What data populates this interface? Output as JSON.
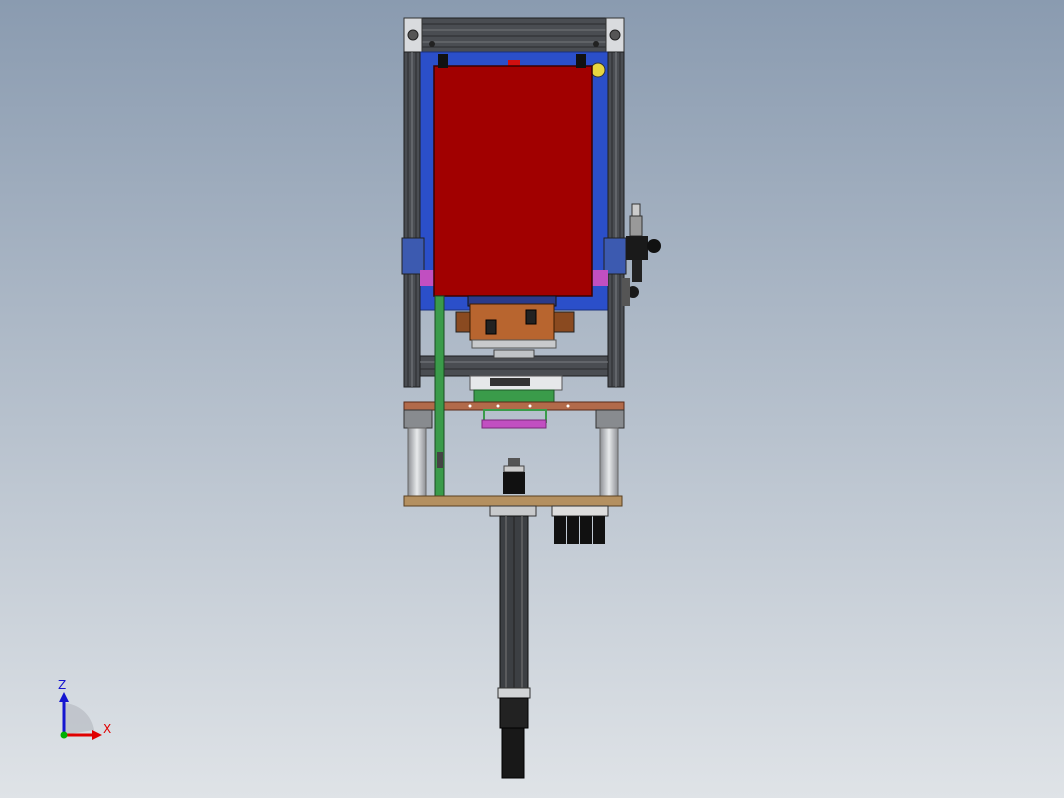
{
  "viewport": {
    "background_top": "#8a9bb0",
    "background_bottom": "#dfe3e7"
  },
  "colors": {
    "frame_gray": "#4a4d52",
    "frame_dark": "#2c2e31",
    "enclosure_red": "#a10000",
    "back_panel_blue": "#2b4fc9",
    "copper_plate": "#b26a4a",
    "wood_plate": "#b49060",
    "orange_block": "#b8652f",
    "green_rail": "#3a9b4a",
    "magenta": "#c14fc1",
    "axis_x": "#e00000",
    "axis_y": "#00b000",
    "axis_z": "#1515d0"
  },
  "triad": {
    "z_label": "Z",
    "x_label": "X"
  },
  "model_parts": [
    {
      "name": "aluminum-extrusion-frame"
    },
    {
      "name": "red-enclosure-panel"
    },
    {
      "name": "blue-back-panel"
    },
    {
      "name": "orange-gearbox-block"
    },
    {
      "name": "rotary-table"
    },
    {
      "name": "copper-mounting-plate"
    },
    {
      "name": "wood-base-plate"
    },
    {
      "name": "linear-actuator"
    },
    {
      "name": "pneumatic-valve"
    },
    {
      "name": "green-guide-rail"
    }
  ]
}
